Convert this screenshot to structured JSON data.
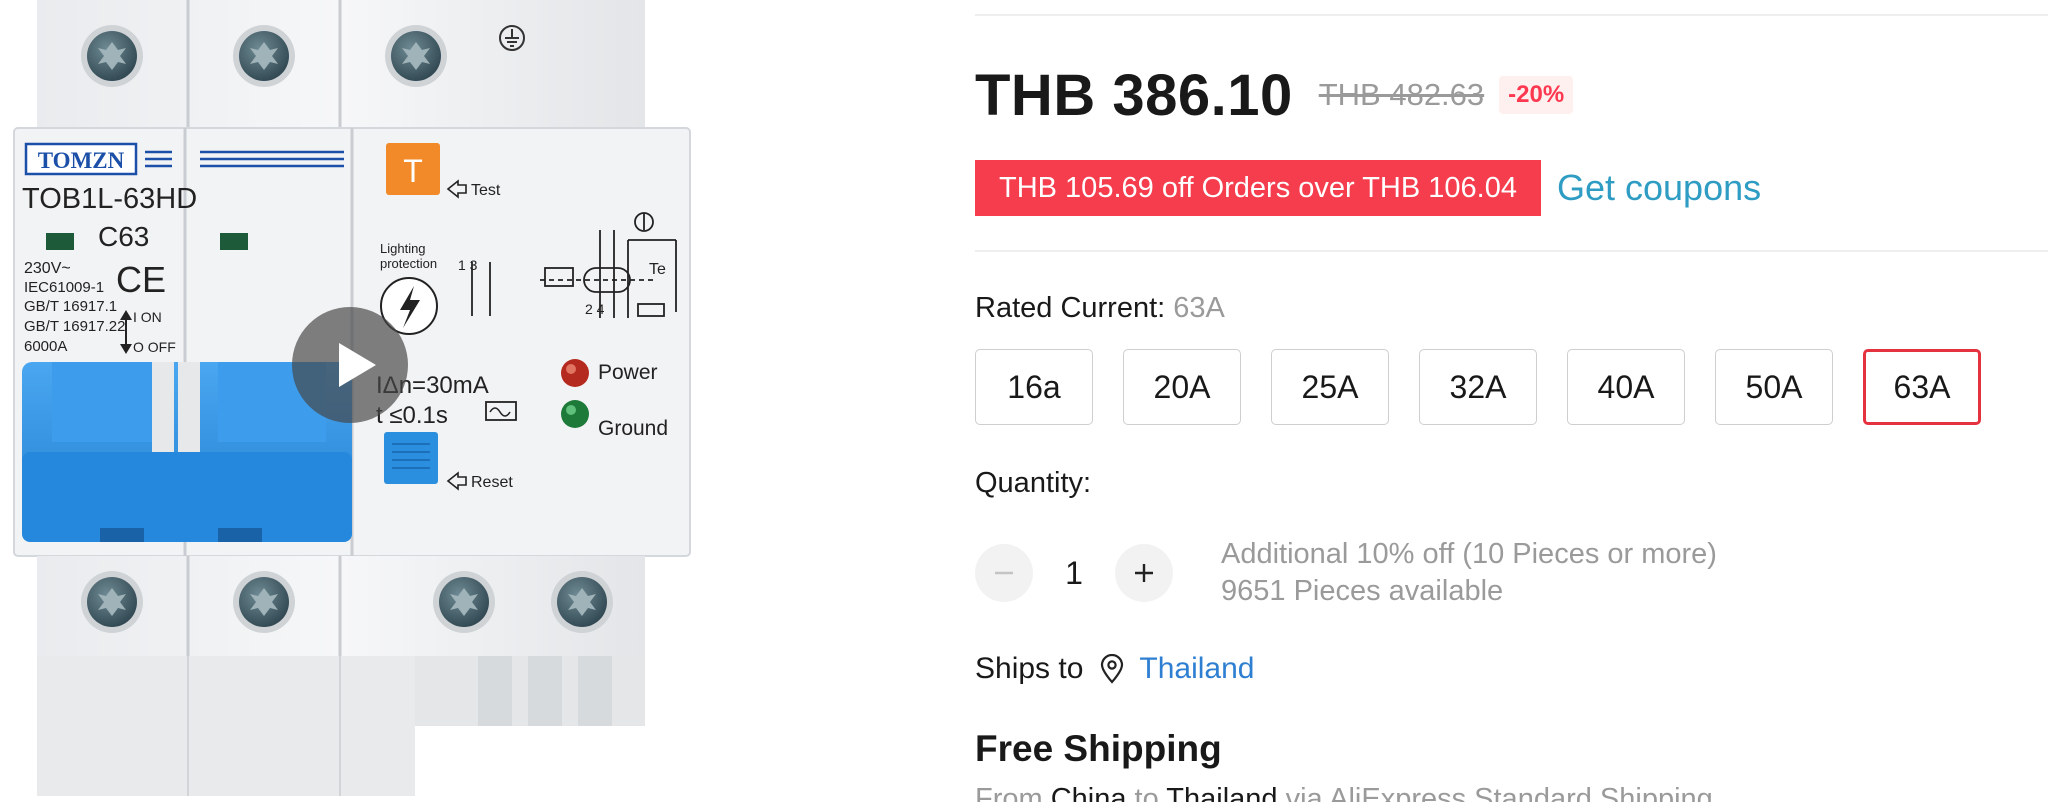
{
  "price": {
    "current": "THB 386.10",
    "original": "THB 482.63",
    "discount": "-20%"
  },
  "coupon": {
    "badge": "THB 105.69 off Orders over THB 106.04",
    "link": "Get coupons"
  },
  "sku": {
    "title": "Rated Current: ",
    "selected_value": "63A",
    "options": [
      "16a",
      "20A",
      "25A",
      "32A",
      "40A",
      "50A",
      "63A"
    ],
    "selected_index": 6
  },
  "quantity": {
    "title": "Quantity:",
    "value": "1",
    "note_discount": "Additional 10% off (10 Pieces or more)",
    "note_available": "9651 Pieces available"
  },
  "shipping": {
    "ships_to_label": "Ships to",
    "country": "Thailand",
    "title": "Free Shipping",
    "detail_from": "From ",
    "detail_origin": "China",
    "detail_to": " to ",
    "detail_dest": "Thailand",
    "detail_via": " via AliExpress Standard Shipping"
  },
  "product_image": {
    "brand": "TOMZN",
    "model": "TOB1L-63HD",
    "rating": "C63",
    "voltage": "230V~",
    "standard_1": "IEC61009-1",
    "standard_2": "GB/T 16917.1",
    "standard_3": "GB/T 16917.22",
    "capacity": "6000A",
    "ce_mark": "CE",
    "on_label": "I ON",
    "off_label": "O OFF",
    "test_key": "T",
    "test_label": "Test",
    "reset_label": "Reset",
    "lighting_1": "Lighting",
    "lighting_2": "protection",
    "residual_current": "IΔn=30mA",
    "trip_time": "t  ≤0.1s",
    "power_label": "Power",
    "ground_label": "Ground",
    "diagram_left": "1 3",
    "diagram_bottom": "2 4",
    "diagram_te": "Te"
  },
  "colors": {
    "price_red": "#fd384f",
    "coupon_red": "#f53d4d",
    "link_blue": "#2e9cc3",
    "country_blue": "#2e7fd2",
    "selected_border": "#e5323f",
    "breaker_blue": "#2b8fe0",
    "brand_blue": "#1b4fa8"
  },
  "icons": {
    "play": "play-icon",
    "minus": "minus-icon",
    "plus": "plus-icon",
    "location": "location-pin-icon",
    "ground": "ground-symbol-icon",
    "lightning": "lightning-icon"
  }
}
